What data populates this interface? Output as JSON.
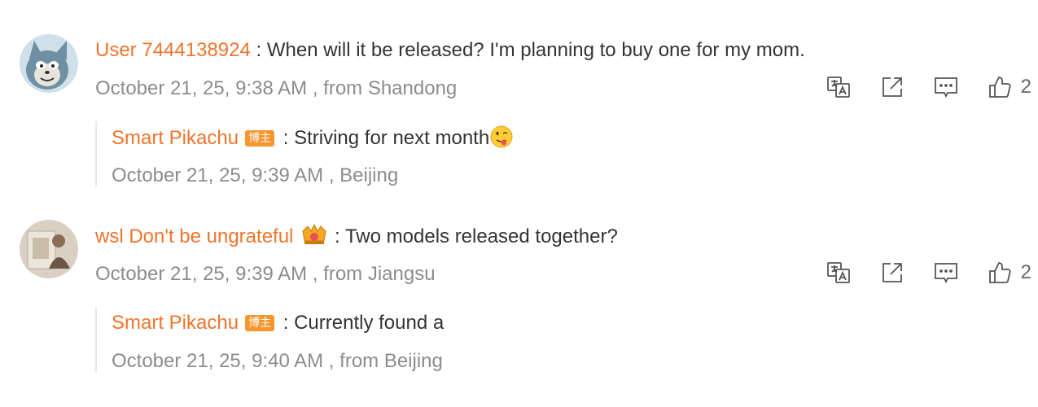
{
  "comments": [
    {
      "user": "User 7444138924",
      "separator": " : ",
      "text": "When will it be released? I'm planning to buy one for my mom.",
      "time": "October 21, 25, 9:38 AM",
      "location": " , from Shandong",
      "likes": "2",
      "reply": {
        "user": "Smart Pikachu",
        "badge": "博主",
        "separator": " : ",
        "text": "Striving for next month",
        "time": "October 21, 25, 9:39 AM",
        "location": " , Beijing"
      }
    },
    {
      "user": "wsl Don't be ungrateful",
      "separator": " : ",
      "text": "Two models released together?",
      "time": "October 21, 25, 9:39 AM",
      "location": " , from Jiangsu",
      "likes": "2",
      "reply": {
        "user": "Smart Pikachu",
        "badge": "博主",
        "separator": " : ",
        "text": "Currently found a",
        "time": "October 21, 25, 9:40 AM",
        "location": " , from Beijing"
      }
    }
  ],
  "icons": {
    "translate": "translate-icon",
    "share": "share-icon",
    "comment": "comment-icon",
    "like": "like-icon",
    "tongue_emoji": "tongue-emoji-icon",
    "crown_badge": "crown-badge-icon"
  },
  "colors": {
    "username": "#f0742c",
    "meta": "#8c8c8c",
    "badge": "#f7962e",
    "text": "#333333"
  }
}
